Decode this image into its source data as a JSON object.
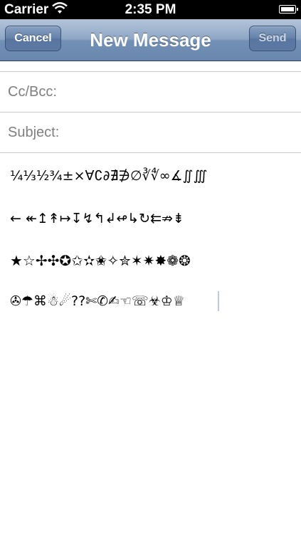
{
  "status": {
    "carrier": "Carrier",
    "time": "2:35 PM",
    "battery_level": 1.0
  },
  "nav": {
    "title": "New Message",
    "cancel_label": "Cancel",
    "send_label": "Send"
  },
  "fields": {
    "cc_label": "Cc/Bcc:",
    "subject_label": "Subject:"
  },
  "body": {
    "lines": [
      "¼⅓½¾±×∀∁∂∄∌∅∛∜∞∡∬∭",
      "← ↞↥↟↦↧↯↰↲↫↳↻⇇⇏⇟",
      "★☆✢✣✪✩✫✬✧✮✶✷✸❁❂",
      "✇☂⌘☃☄??✄✆✍☜☏☣♔♕"
    ]
  }
}
